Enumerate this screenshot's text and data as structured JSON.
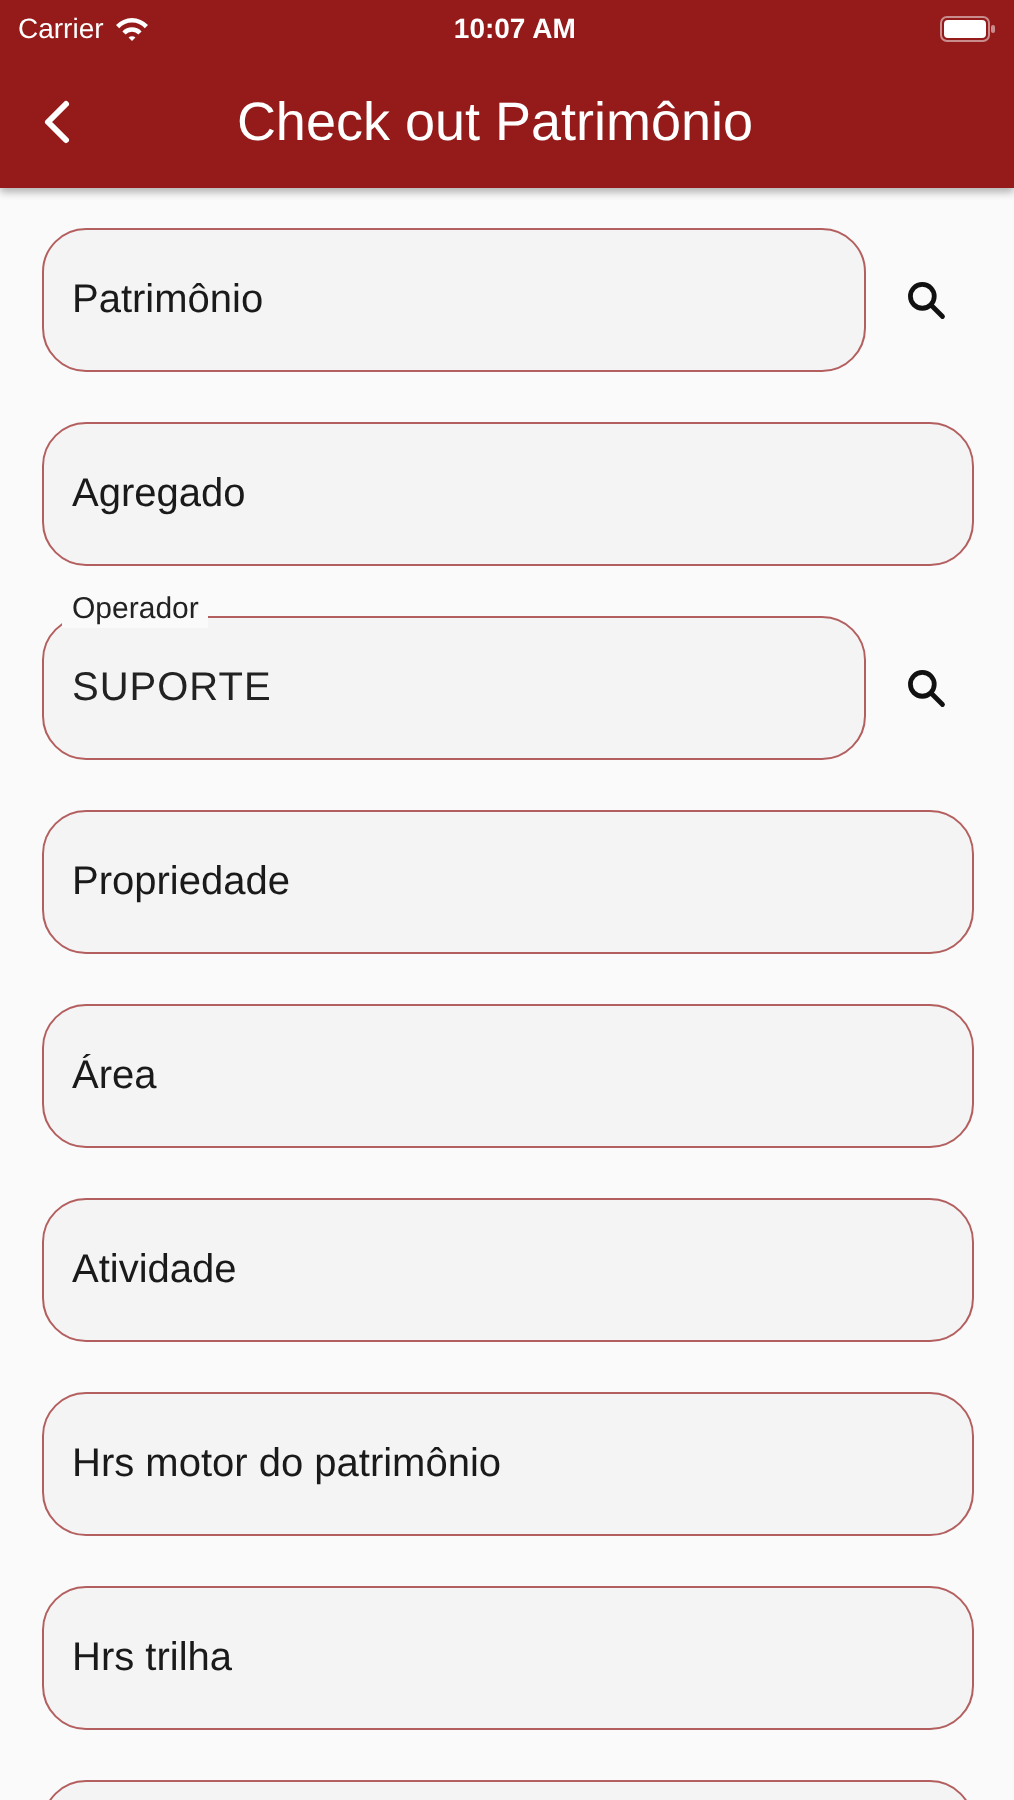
{
  "status_bar": {
    "carrier": "Carrier",
    "time": "10:07 AM"
  },
  "nav": {
    "title": "Check out Patrimônio"
  },
  "fields": [
    {
      "placeholder": "Patrimônio",
      "search": true
    },
    {
      "placeholder": "Agregado",
      "search": false
    },
    {
      "label": "Operador",
      "value": "SUPORTE",
      "search": true
    },
    {
      "placeholder": "Propriedade",
      "search": false
    },
    {
      "placeholder": "Área",
      "search": false
    },
    {
      "placeholder": "Atividade",
      "search": false
    },
    {
      "placeholder": "Hrs motor do patrimônio",
      "search": false
    },
    {
      "placeholder": "Hrs trilha",
      "search": false
    },
    {
      "search": false
    }
  ]
}
